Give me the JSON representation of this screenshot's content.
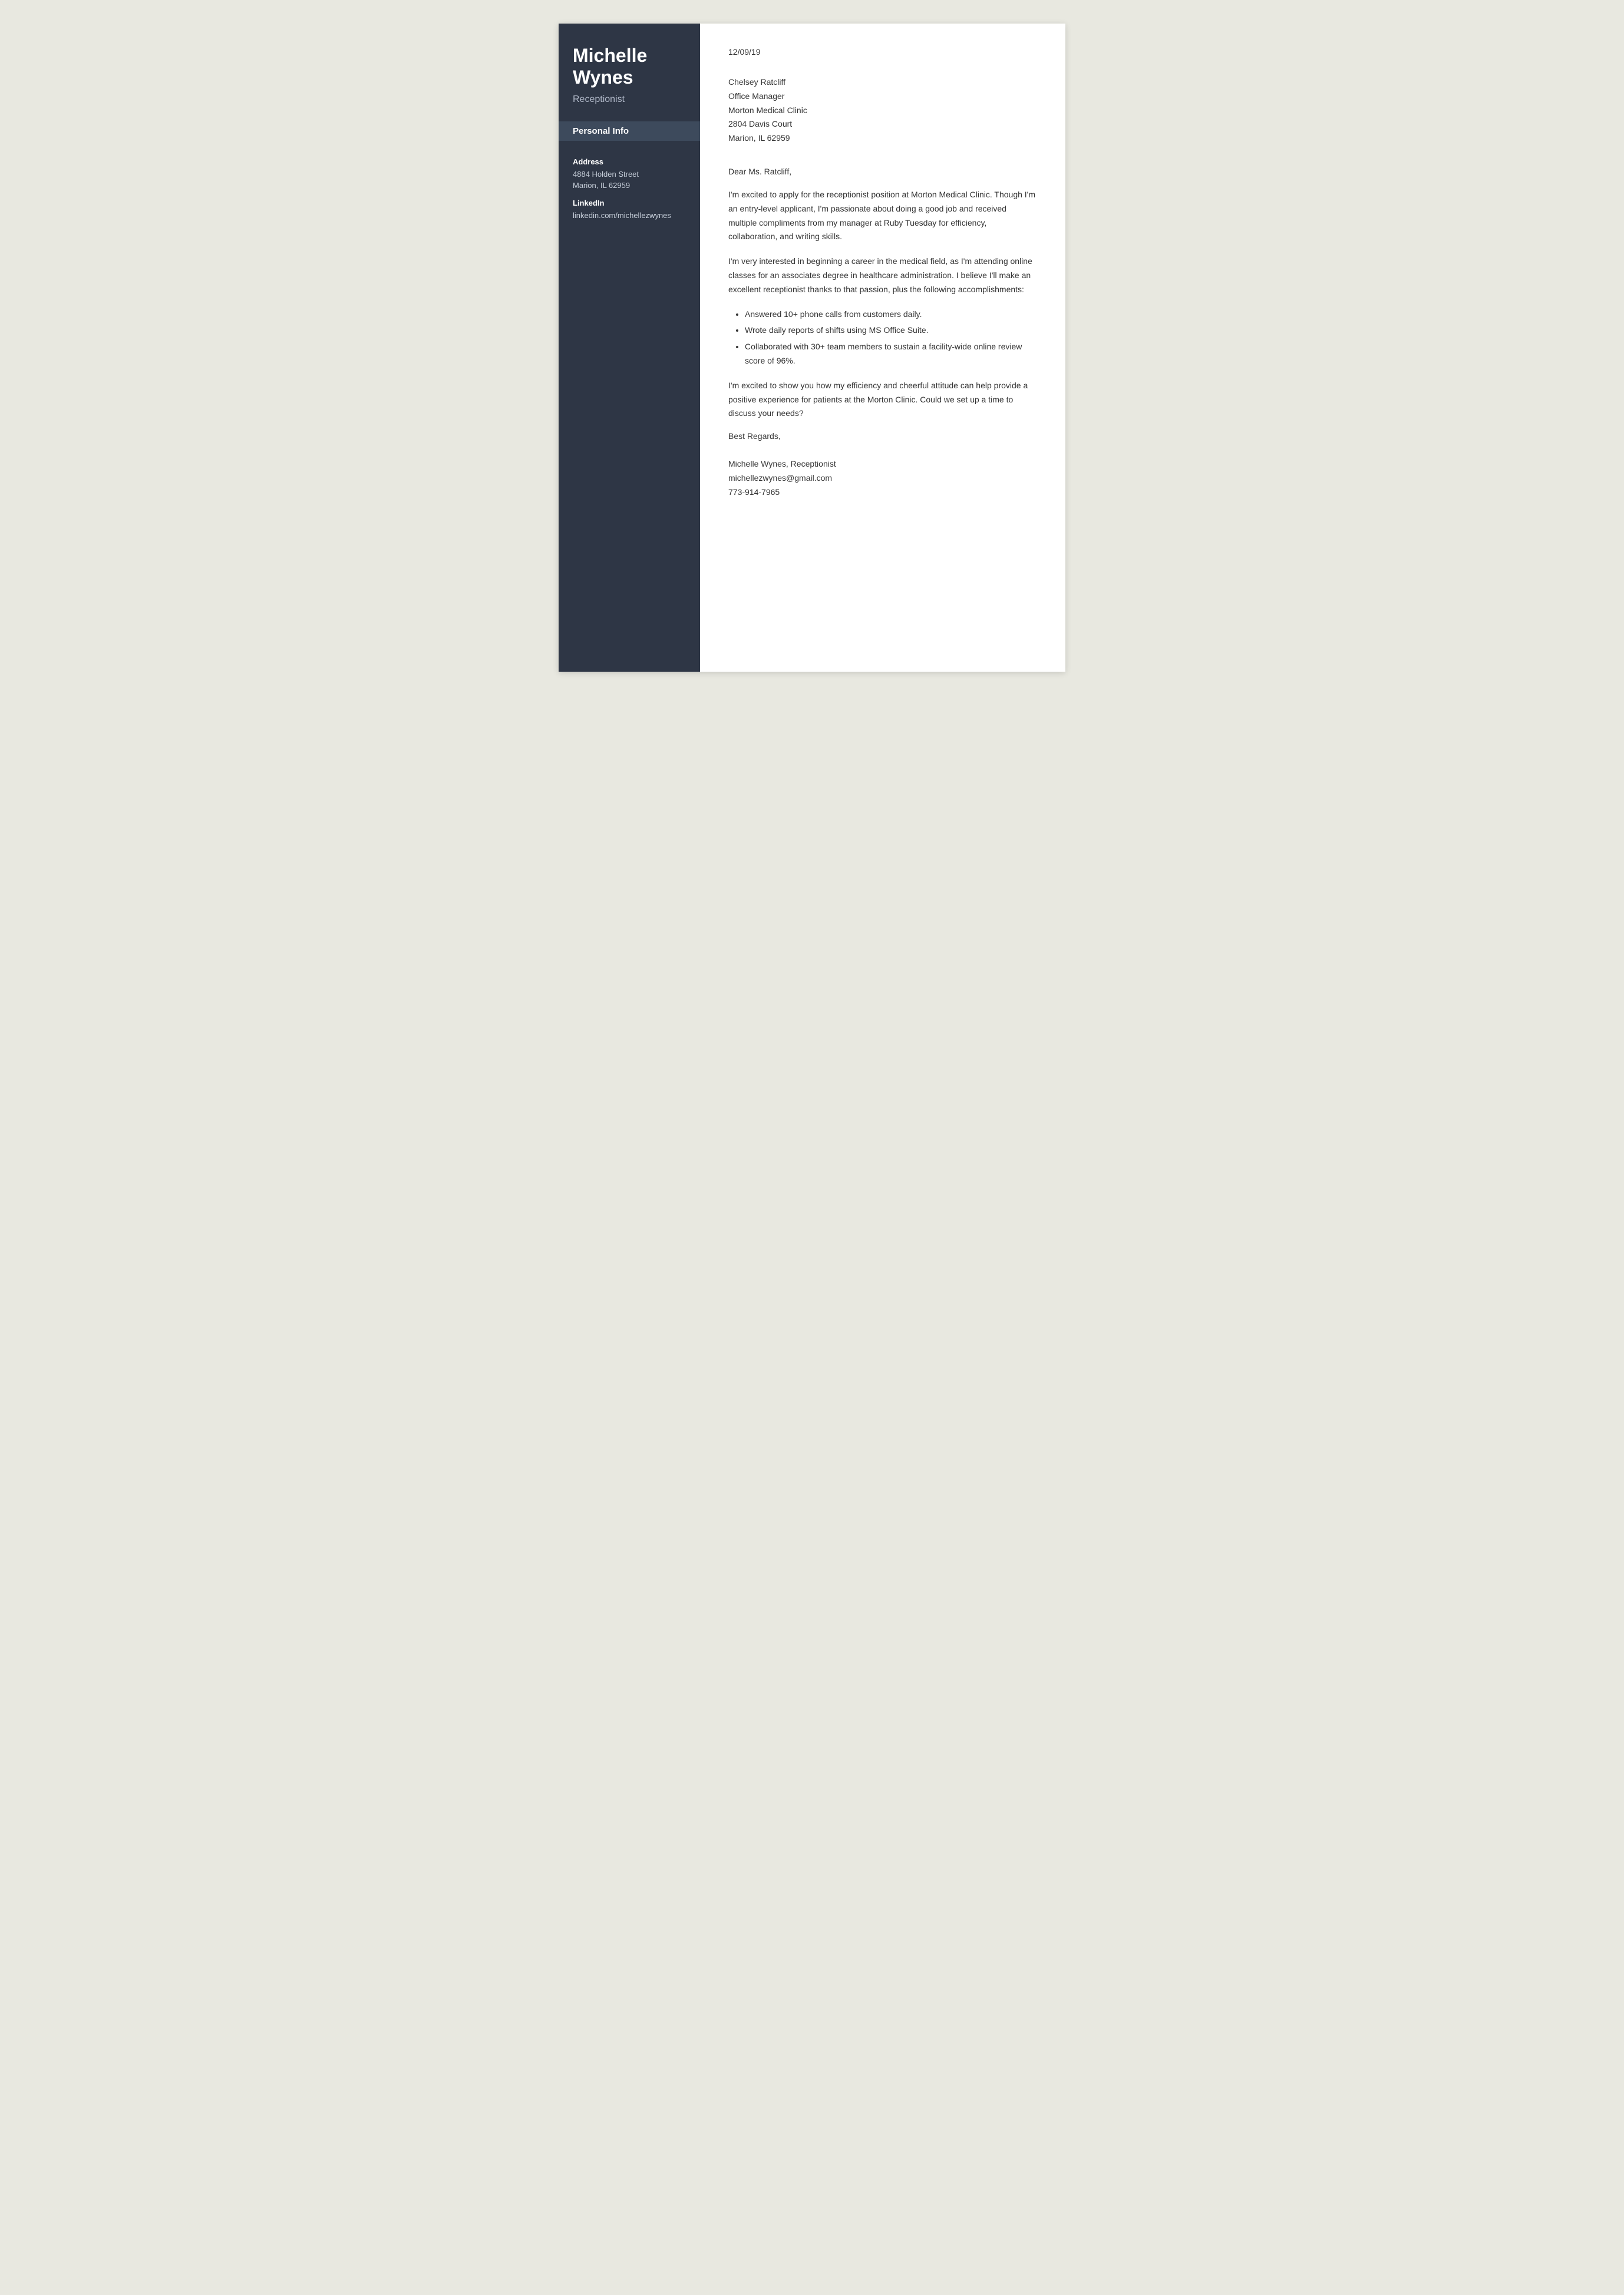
{
  "sidebar": {
    "name_line1": "Michelle",
    "name_line2": "Wynes",
    "title": "Receptionist",
    "personal_info_header": "Personal Info",
    "address_label": "Address",
    "address_line1": "4884 Holden Street",
    "address_line2": "Marion, IL 62959",
    "linkedin_label": "LinkedIn",
    "linkedin_value": "linkedin.com/michellezwynes"
  },
  "letter": {
    "date": "12/09/19",
    "recipient_name": "Chelsey Ratcliff",
    "recipient_title": "Office Manager",
    "recipient_company": "Morton Medical Clinic",
    "recipient_address1": "2804 Davis Court",
    "recipient_address2": "Marion, IL 62959",
    "salutation": "Dear Ms. Ratcliff,",
    "paragraph1": "I'm excited to apply for the receptionist position at Morton Medical Clinic. Though I'm an entry-level applicant, I'm passionate about doing a good job and received multiple compliments from my manager at Ruby Tuesday for efficiency, collaboration, and writing skills.",
    "paragraph2": "I'm very interested in beginning a career in the medical field, as I'm attending online classes for an associates degree in healthcare administration. I believe I'll make an excellent receptionist thanks to that passion, plus the following accomplishments:",
    "bullet1": "Answered 10+ phone calls from customers daily.",
    "bullet2": "Wrote daily reports of shifts using MS Office Suite.",
    "bullet3": "Collaborated with 30+ team members to sustain a facility-wide online review score of 96%.",
    "paragraph3": "I'm excited to show you how my efficiency and cheerful attitude can help provide a positive experience for patients at the Morton Clinic. Could we set up a time to discuss your needs?",
    "closing": "Best Regards,",
    "signature_name": "Michelle Wynes, Receptionist",
    "signature_email": "michellezwynes@gmail.com",
    "signature_phone": "773-914-7965"
  }
}
